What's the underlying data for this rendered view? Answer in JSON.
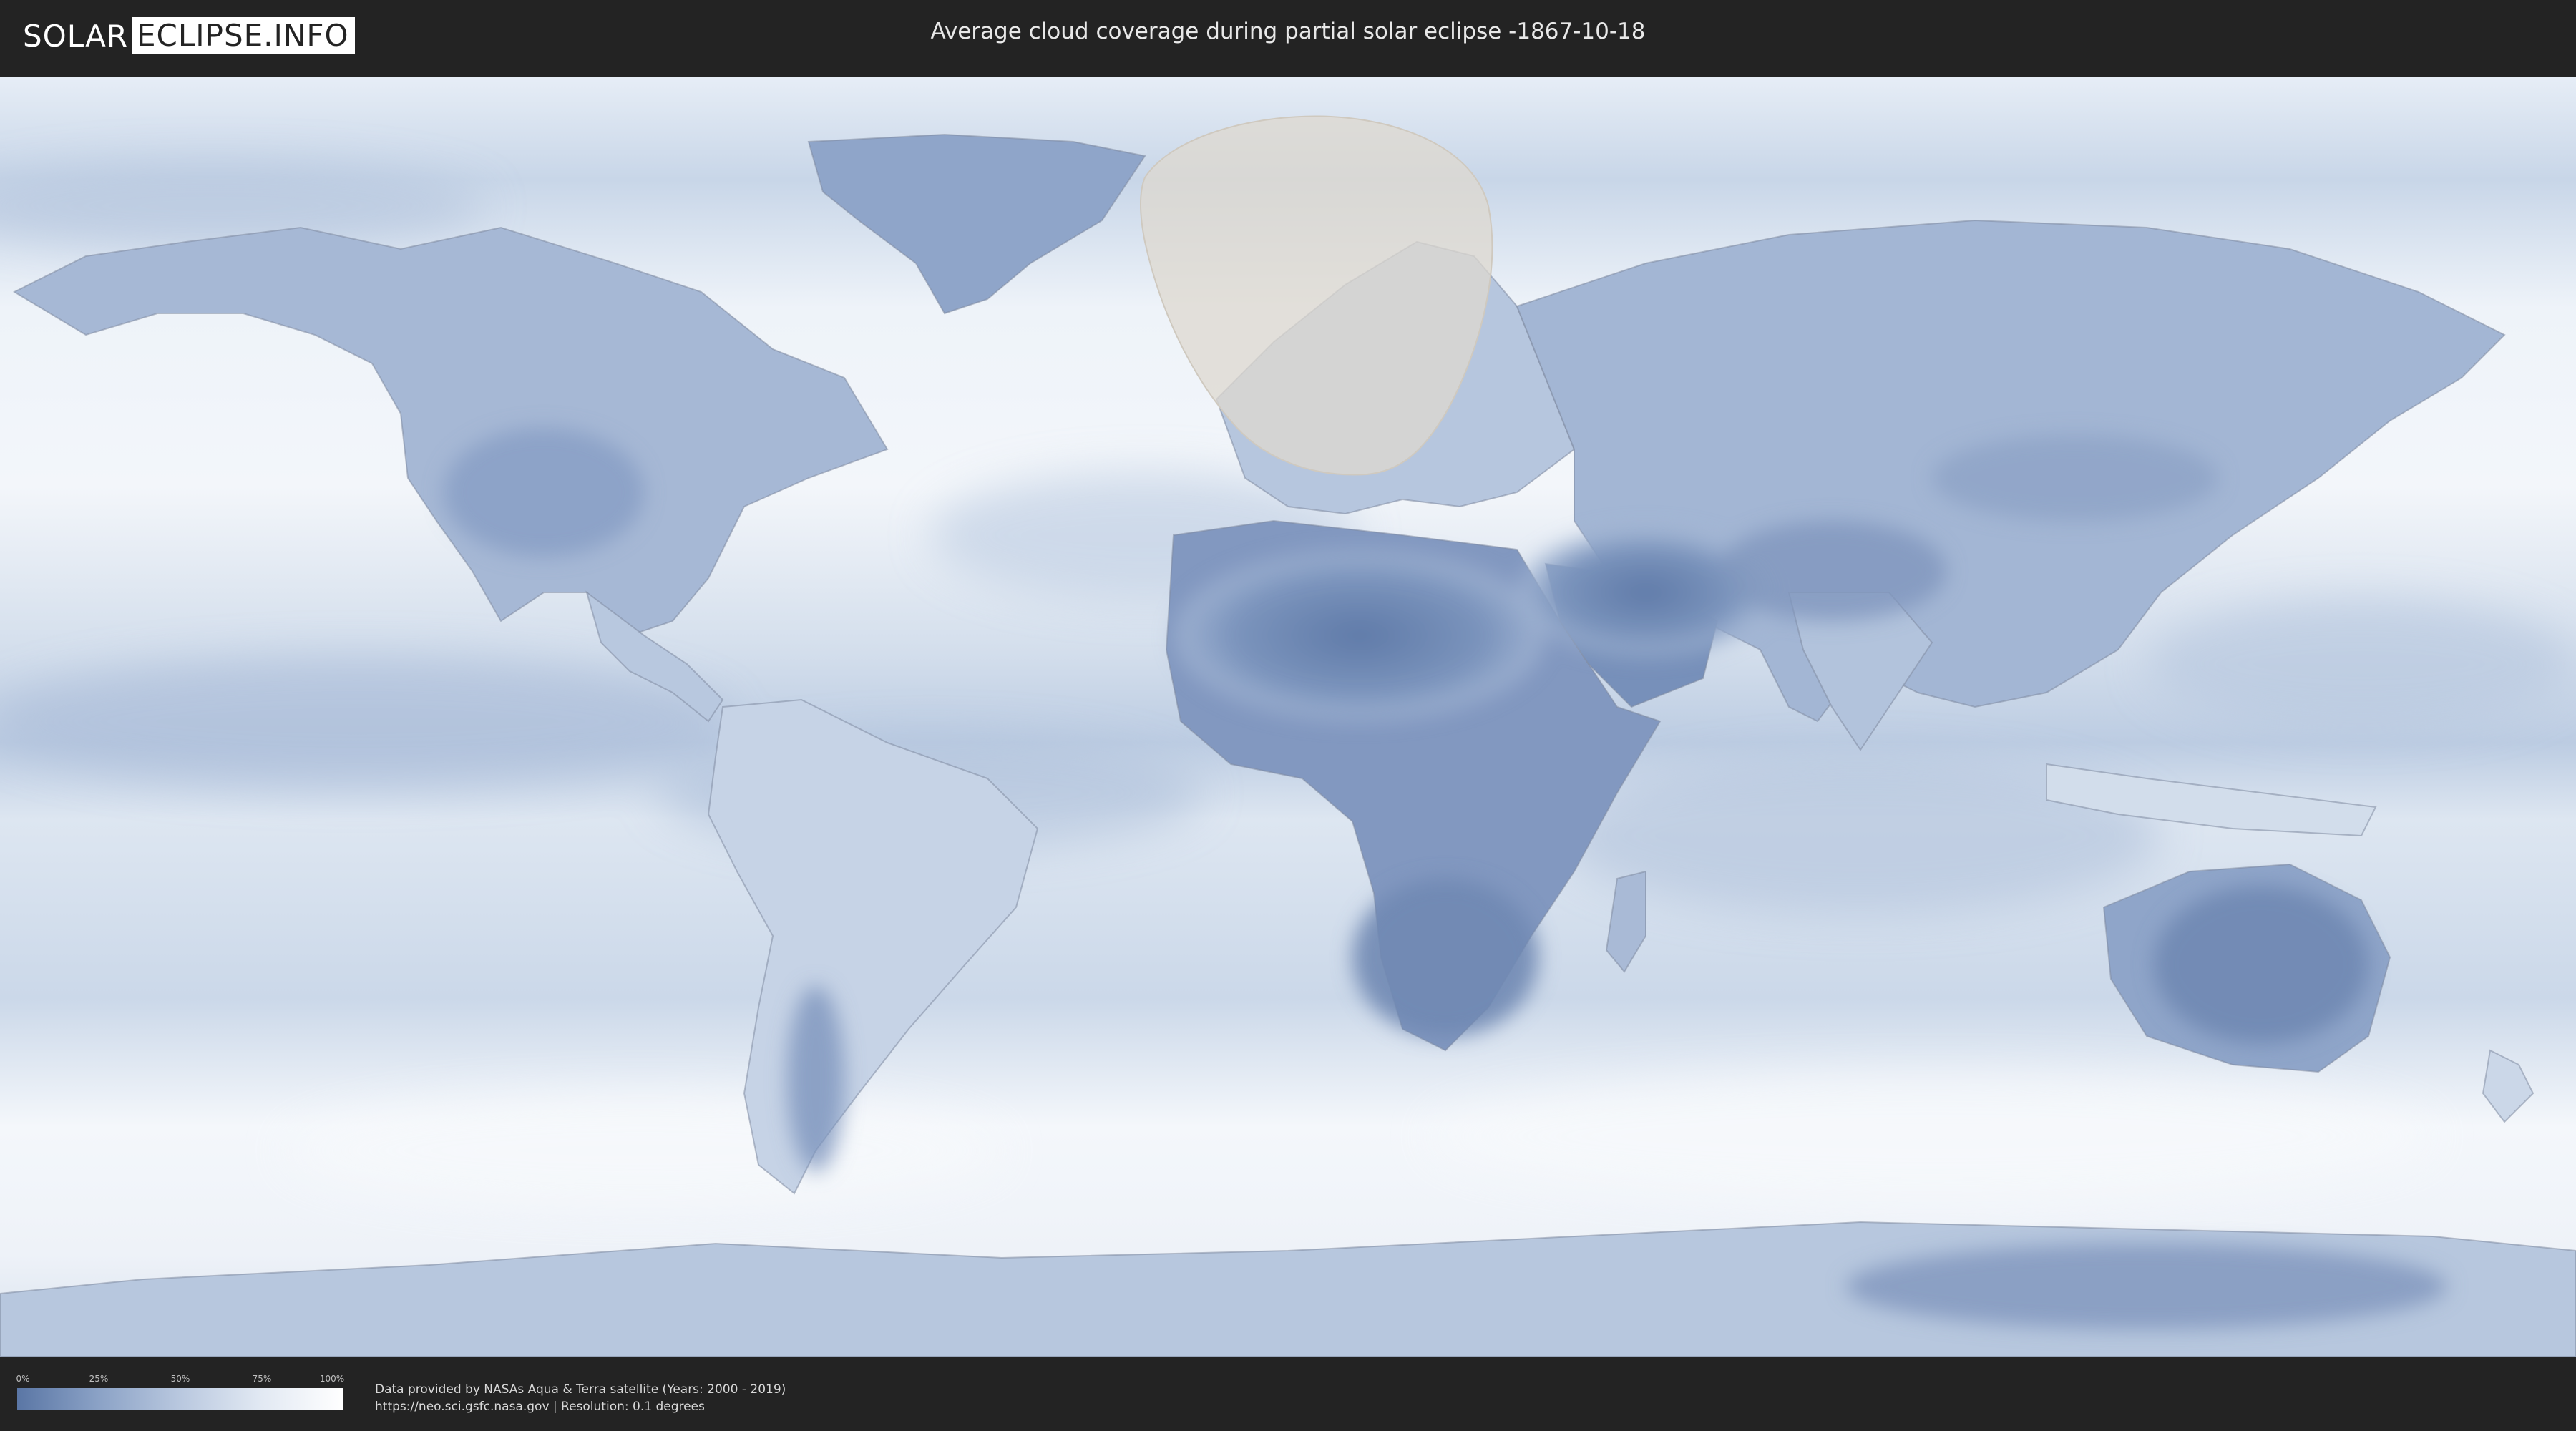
{
  "header": {
    "logo_solar": "SOLAR",
    "logo_rest": "ECLIPSE.INFO",
    "title": "Average cloud coverage during partial solar eclipse -1867-10-18"
  },
  "map": {
    "type": "world-cloud-coverage",
    "projection": "equirectangular",
    "eclipse_region": "partial eclipse visibility over North Atlantic, Scandinavia, Europe",
    "colors": {
      "clear": "#5a76a5",
      "cloudy": "#ffffff",
      "eclipse_overlay": "#d8d4cc",
      "borders": "#7a8594"
    }
  },
  "legend": {
    "ticks": [
      "0%",
      "25%",
      "50%",
      "75%",
      "100%"
    ],
    "gradient_start": "#5a76a5",
    "gradient_end": "#ffffff"
  },
  "credits": {
    "line1": "Data provided by NASAs Aqua & Terra satellite (Years: 2000 - 2019)",
    "line2": "https://neo.sci.gsfc.nasa.gov | Resolution: 0.1 degrees"
  }
}
